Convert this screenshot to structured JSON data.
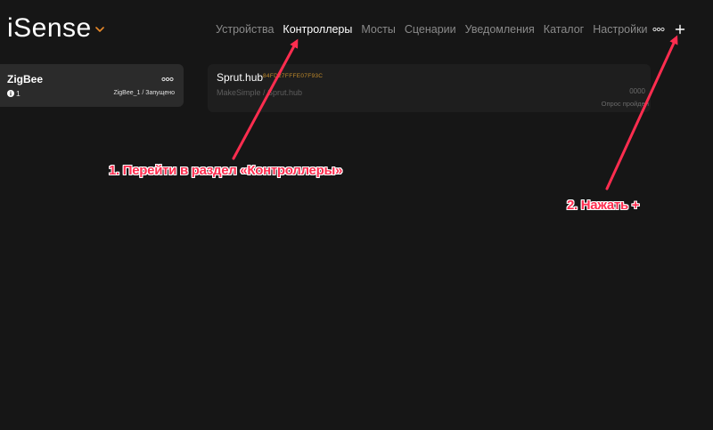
{
  "header": {
    "logo": "iSense",
    "nav_tabs": [
      {
        "label": "Устройства",
        "active": false
      },
      {
        "label": "Контроллеры",
        "active": true
      },
      {
        "label": "Мосты",
        "active": false
      },
      {
        "label": "Сценарии",
        "active": false
      },
      {
        "label": "Уведомления",
        "active": false
      },
      {
        "label": "Каталог",
        "active": false
      },
      {
        "label": "Настройки",
        "active": false
      }
    ],
    "more_icon": "more-horizontal-icon",
    "add_label": "+"
  },
  "sidebar": {
    "controller": {
      "title": "ZigBee",
      "info_count": "1",
      "status": "ZigBee_1 / Запущено"
    }
  },
  "main": {
    "hub_card": {
      "title": "Sprut.hub",
      "id": "84FD27FFFE07F93C",
      "vendor": "MakeSimple / Sprut.hub",
      "code": "0000",
      "poll_status": "Опрос пройден"
    }
  },
  "annotations": {
    "step1": "1. Перейти в раздел «Контроллеры»",
    "step2": "2. Нажать +"
  },
  "colors": {
    "background": "#161616",
    "card": "#2b2b2b",
    "accent_orange": "#e8892a",
    "annotation_red": "#ff2d4f"
  }
}
